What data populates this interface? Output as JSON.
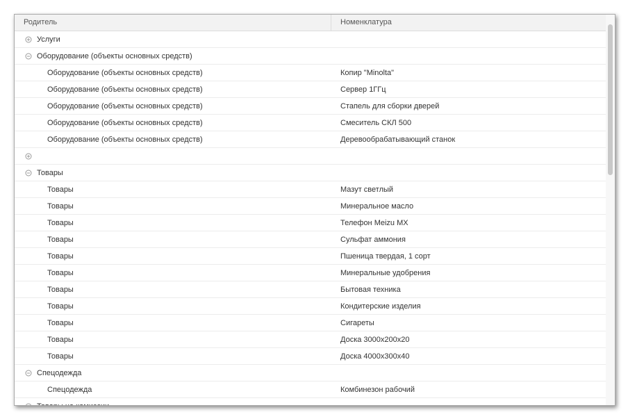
{
  "table": {
    "columns": {
      "parent": "Родитель",
      "nomenclature": "Номенклатура"
    },
    "rows": [
      {
        "type": "group",
        "expanded": false,
        "parent": "Услуги",
        "nomenclature": ""
      },
      {
        "type": "group",
        "expanded": true,
        "parent": "Оборудование (объекты основных средств)",
        "nomenclature": ""
      },
      {
        "type": "child",
        "parent": "Оборудование (объекты основных средств)",
        "nomenclature": "Копир \"Minolta\""
      },
      {
        "type": "child",
        "parent": "Оборудование (объекты основных средств)",
        "nomenclature": "Сервер 1ГГц"
      },
      {
        "type": "child",
        "parent": "Оборудование (объекты основных средств)",
        "nomenclature": "Стапель для сборки дверей"
      },
      {
        "type": "child",
        "parent": "Оборудование (объекты основных средств)",
        "nomenclature": "Смеситель СКЛ 500"
      },
      {
        "type": "child",
        "parent": "Оборудование (объекты основных средств)",
        "nomenclature": "Деревообрабатывающий станок"
      },
      {
        "type": "group",
        "expanded": false,
        "parent": "",
        "nomenclature": ""
      },
      {
        "type": "group",
        "expanded": true,
        "parent": "Товары",
        "nomenclature": ""
      },
      {
        "type": "child",
        "parent": "Товары",
        "nomenclature": "Мазут светлый"
      },
      {
        "type": "child",
        "parent": "Товары",
        "nomenclature": "Минеральное масло"
      },
      {
        "type": "child",
        "parent": "Товары",
        "nomenclature": "Телефон Meizu MX"
      },
      {
        "type": "child",
        "parent": "Товары",
        "nomenclature": "Сульфат аммония"
      },
      {
        "type": "child",
        "parent": "Товары",
        "nomenclature": "Пшеница твердая, 1 сорт"
      },
      {
        "type": "child",
        "parent": "Товары",
        "nomenclature": "Минеральные удобрения"
      },
      {
        "type": "child",
        "parent": "Товары",
        "nomenclature": "Бытовая техника"
      },
      {
        "type": "child",
        "parent": "Товары",
        "nomenclature": "Кондитерские изделия"
      },
      {
        "type": "child",
        "parent": "Товары",
        "nomenclature": "Сигареты"
      },
      {
        "type": "child",
        "parent": "Товары",
        "nomenclature": "Доска 3000x200x20"
      },
      {
        "type": "child",
        "parent": "Товары",
        "nomenclature": "Доска 4000x300x40"
      },
      {
        "type": "group",
        "expanded": true,
        "parent": "Спецодежда",
        "nomenclature": ""
      },
      {
        "type": "child",
        "parent": "Спецодежда",
        "nomenclature": "Комбинезон рабочий"
      },
      {
        "type": "group",
        "expanded": true,
        "parent": "Товары на комиссии",
        "nomenclature": ""
      }
    ]
  },
  "icons": {
    "expand": "plus-circle-icon",
    "collapse": "minus-circle-icon"
  },
  "colors": {
    "header_bg": "#f2f2f2",
    "row_border": "#ececec",
    "text": "#333333",
    "toggle": "#9a9a9a"
  }
}
